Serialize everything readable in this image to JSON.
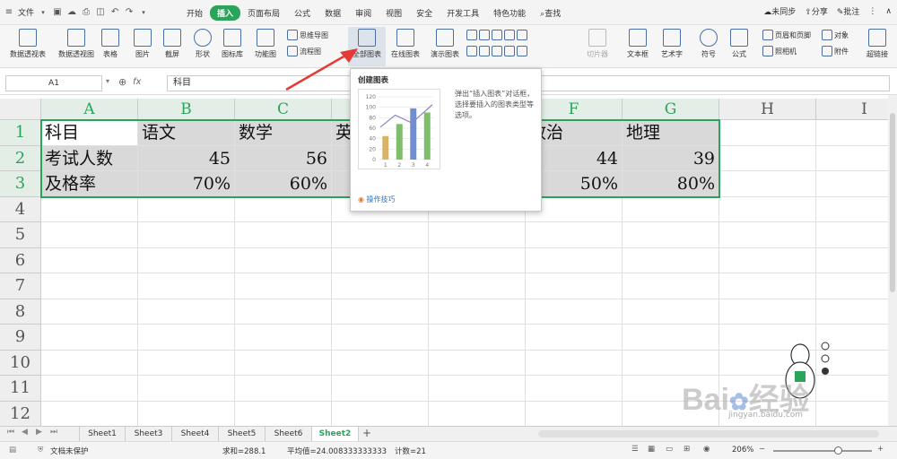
{
  "menubar": {
    "file": "文件",
    "tabs": [
      "开始",
      "插入",
      "页面布局",
      "公式",
      "数据",
      "审阅",
      "视图",
      "安全",
      "开发工具",
      "特色功能"
    ],
    "active_tab": "插入",
    "search": "查找",
    "sync": "未同步",
    "share": "分享",
    "comment": "批注"
  },
  "ribbon": {
    "items": [
      "数据透视表",
      "数据透视图",
      "表格",
      "图片",
      "截屏",
      "形状",
      "图标库",
      "功能图",
      "全部图表",
      "在线图表",
      "演示图表",
      "切片器",
      "文本框",
      "艺术字",
      "符号",
      "公式",
      "超链接"
    ],
    "mindmap": "思维导图",
    "flowchart": "流程图",
    "header_footer": "页眉和页脚",
    "object": "对象",
    "camera": "照相机",
    "attachment": "附件"
  },
  "formulabar": {
    "cell_ref": "A1",
    "fx": "fx",
    "content": "科目"
  },
  "grid": {
    "columns": [
      "A",
      "B",
      "C",
      "D",
      "E",
      "F",
      "G",
      "H",
      "I"
    ],
    "rows": [
      "1",
      "2",
      "3",
      "4",
      "5",
      "6",
      "7",
      "8",
      "9",
      "10",
      "11",
      "12"
    ],
    "r1": [
      "科目",
      "语文",
      "数学",
      "英",
      "",
      "政治",
      "地理"
    ],
    "r2": [
      "考试人数",
      "45",
      "56",
      "",
      "",
      "44",
      "39"
    ],
    "r3": [
      "及格率",
      "70%",
      "60%",
      "",
      "",
      "50%",
      "80%"
    ]
  },
  "tooltip": {
    "title": "创建图表",
    "desc": "弹出“插入图表”对话框，选择要插入的图表类型等选项。",
    "link": "操作技巧",
    "yticks": [
      "120",
      "100",
      "80",
      "60",
      "40",
      "20",
      "0"
    ],
    "xticks": [
      "1",
      "2",
      "3",
      "4"
    ]
  },
  "chart_data": {
    "type": "bar",
    "categories": [
      "1",
      "2",
      "3",
      "4"
    ],
    "series": [
      {
        "values": [
          45,
          68,
          98,
          90
        ]
      },
      {
        "values": [
          62,
          85,
          70,
          105
        ]
      }
    ],
    "ylim": [
      0,
      120
    ],
    "bar_colors": [
      "#d9b36a",
      "#7dbd6b",
      "#6e8fd1",
      "#7dbd6b"
    ],
    "line_color": "#8b85c0"
  },
  "sheets": [
    "Sheet1",
    "Sheet3",
    "Sheet4",
    "Sheet5",
    "Sheet6",
    "Sheet2"
  ],
  "active_sheet": "Sheet2",
  "status": {
    "protect": "文档未保护",
    "sum": "求和=288.1",
    "avg": "平均值=24.008333333333",
    "count": "计数=21",
    "zoom": "206%"
  },
  "watermark": {
    "brand": "Bai",
    "brand2": "经验",
    "url": "jingyan.baidu.com"
  },
  "colors": {
    "accent": "#2aa35b",
    "selection_fill": "#d9d9d9"
  }
}
